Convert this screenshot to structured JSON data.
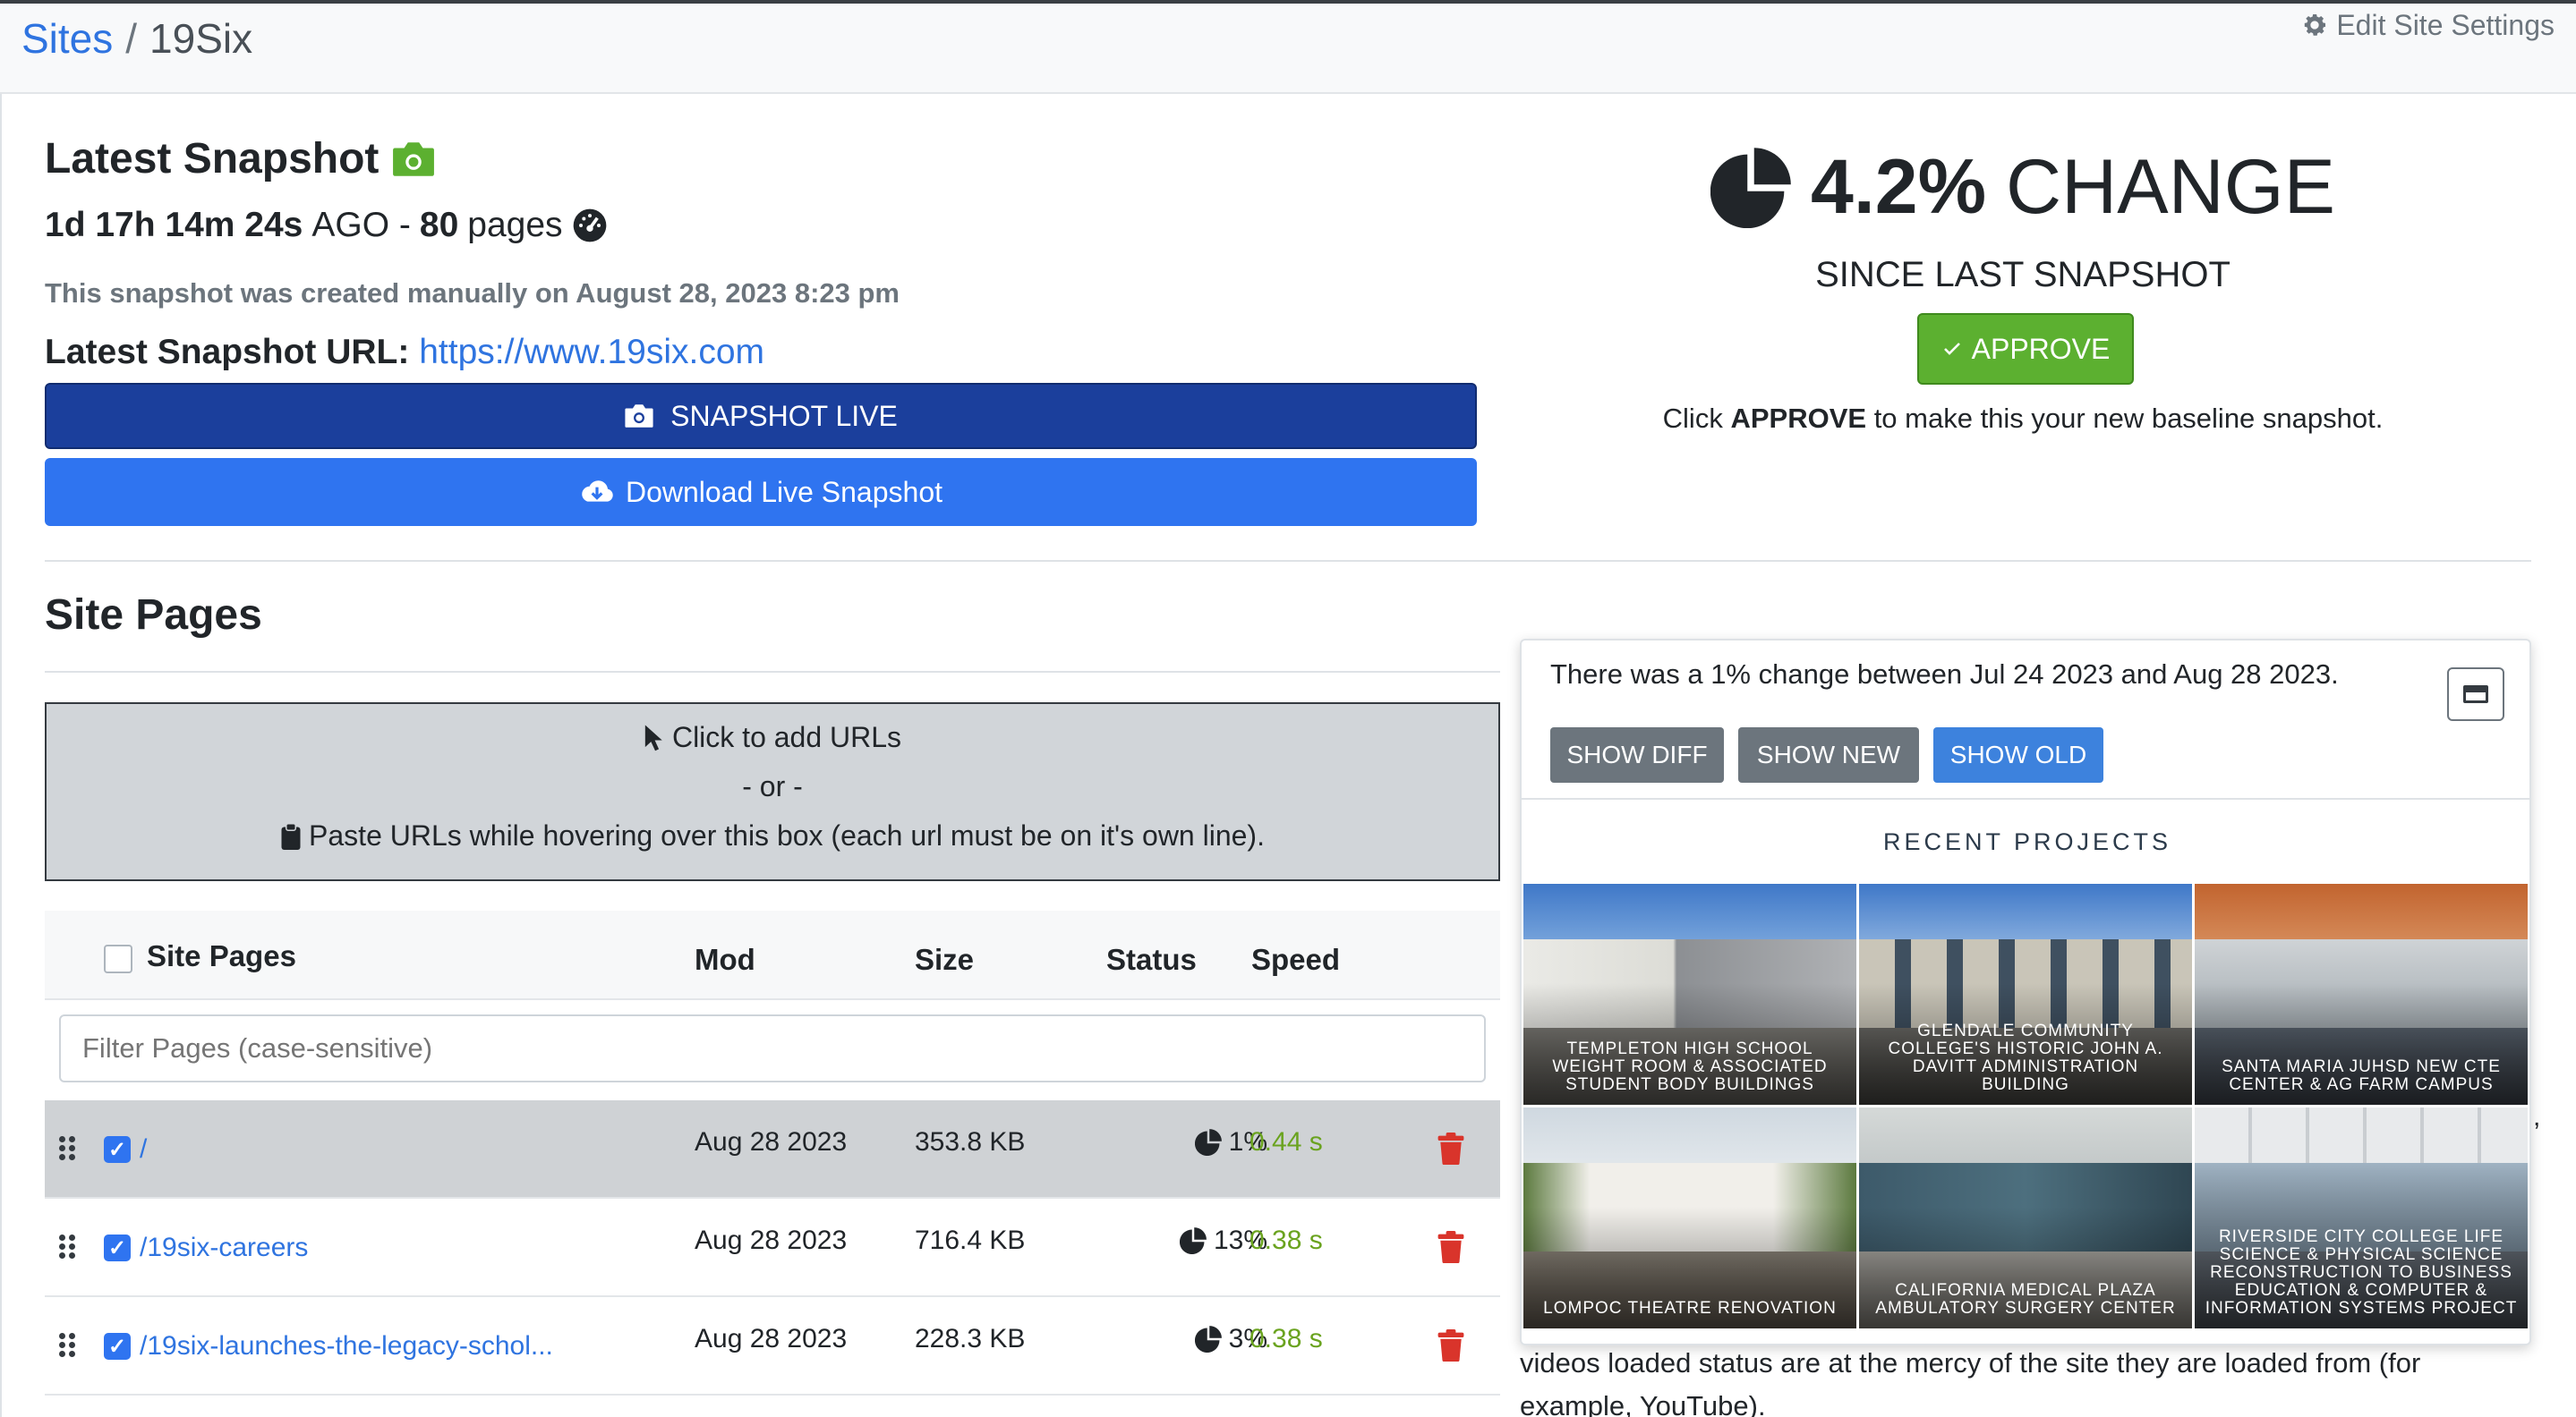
{
  "breadcrumb": {
    "sites": "Sites",
    "sep": "/",
    "current": "19Six"
  },
  "header": {
    "edit_settings": "Edit Site Settings"
  },
  "snapshot": {
    "title": "Latest Snapshot",
    "age": "1d 17h 14m 24s",
    "ago": "AGO -",
    "pages_count": "80",
    "pages_label": "pages",
    "created_text": "This snapshot was created manually on August 28, 2023 8:23 pm",
    "url_label": "Latest Snapshot URL:",
    "url": "https://www.19six.com",
    "btn_live": "SNAPSHOT LIVE",
    "btn_download": "Download Live Snapshot"
  },
  "change": {
    "percent": "4.2%",
    "label": "CHANGE",
    "since": "SINCE LAST SNAPSHOT",
    "approve_btn": "APPROVE",
    "note_pre": "Click",
    "note_bold": "APPROVE",
    "note_post": "to make this your new baseline snapshot."
  },
  "site_pages": {
    "title": "Site Pages",
    "dropzone_line1": "Click to add URLs",
    "dropzone_line2": "- or -",
    "dropzone_line3": "Paste URLs while hovering over this box (each url must be on it's own line).",
    "columns": {
      "pages": "Site Pages",
      "mod": "Mod",
      "size": "Size",
      "status": "Status",
      "speed": "Speed"
    },
    "filter_placeholder": "Filter Pages (case-sensitive)",
    "rows": [
      {
        "path": "/",
        "mod": "Aug 28 2023",
        "size": "353.8 KB",
        "status": "1%",
        "speed": "0.44 s"
      },
      {
        "path": "/19six-careers",
        "mod": "Aug 28 2023",
        "size": "716.4 KB",
        "status": "13%",
        "speed": "0.38 s"
      },
      {
        "path": "/19six-launches-the-legacy-schol...",
        "mod": "Aug 28 2023",
        "size": "228.3 KB",
        "status": "3%",
        "speed": "0.38 s"
      }
    ]
  },
  "popup": {
    "message": "There was a 1% change between Jul 24 2023 and Aug 28 2023.",
    "btn_diff": "SHOW DIFF",
    "btn_new": "SHOW NEW",
    "btn_old": "SHOW OLD",
    "section_title": "RECENT PROJECTS",
    "projects": [
      "TEMPLETON HIGH SCHOOL WEIGHT ROOM & ASSOCIATED STUDENT BODY BUILDINGS",
      "GLENDALE COMMUNITY COLLEGE'S HISTORIC JOHN A. DAVITT ADMINISTRATION BUILDING",
      "SANTA MARIA JUHSD NEW CTE CENTER & AG FARM CAMPUS",
      "LOMPOC THEATRE RENOVATION",
      "CALIFORNIA MEDICAL PLAZA AMBULATORY SURGERY CENTER",
      "RIVERSIDE CITY COLLEGE LIFE SCIENCE & PHYSICAL SCIENCE RECONSTRUCTION TO BUSINESS EDUCATION & COMPUTER & INFORMATION SYSTEMS PROJECT"
    ]
  },
  "background_text": {
    "line": "videos loaded status are at the mercy of the site they are loaded from (for example, YouTube).",
    "edge": ","
  },
  "colors": {
    "link": "#2f74e0",
    "primary": "#2f74f0",
    "dark_primary": "#1b3f9c",
    "success": "#5cb030",
    "danger": "#d9342b",
    "speed": "#6aa31f"
  },
  "icons": [
    "gear-icon",
    "camera-icon",
    "gauge-icon",
    "pie-chart-icon",
    "check-icon",
    "cloud-download-icon",
    "cursor-icon",
    "clipboard-icon",
    "grip-icon",
    "trash-icon",
    "window-maximize-icon"
  ]
}
